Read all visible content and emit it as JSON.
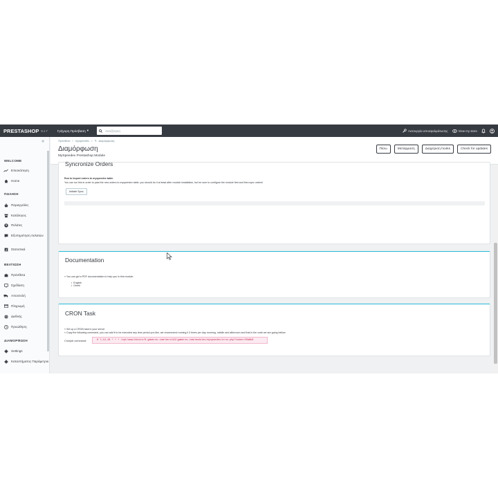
{
  "topbar": {
    "logo": "PRESTASHOP",
    "version": "8.1.7",
    "quick_access": "Γρήγορη Πρόσβαση",
    "search_placeholder": "Αναζήτηση",
    "maintenance": "Λειτουργία αποσφαλμάτωσης",
    "view_store": "View my store"
  },
  "sidebar": {
    "sections": [
      {
        "title": "WELCOME"
      },
      {
        "title": "ΠΩΛΗΣΗ"
      },
      {
        "title": "ΒΕΛΤΙΩΣΗ"
      },
      {
        "title": "ΔΙΑΜΟΡΦΩΣΗ"
      }
    ],
    "items": [
      {
        "label": "Επισκόπηση",
        "icon": "trending-up-icon"
      },
      {
        "label": "Home",
        "icon": "home-icon"
      },
      {
        "label": "Παραγγελίες",
        "icon": "basket-icon"
      },
      {
        "label": "Κατάλογος",
        "icon": "store-icon"
      },
      {
        "label": "Πελάτες",
        "icon": "account-icon"
      },
      {
        "label": "Εξυπηρέτηση πελατών",
        "icon": "chat-icon"
      },
      {
        "label": "Στατιστικά",
        "icon": "stats-icon"
      },
      {
        "label": "Πρόσθετα",
        "icon": "puzzle-icon"
      },
      {
        "label": "Σχεδίαση",
        "icon": "desktop-icon"
      },
      {
        "label": "Αποστολή",
        "icon": "truck-icon"
      },
      {
        "label": "Πληρωμή",
        "icon": "credit-card-icon"
      },
      {
        "label": "Διεθνής",
        "icon": "globe-icon"
      },
      {
        "label": "Προώθηση",
        "icon": "tag-icon"
      },
      {
        "label": "Settings",
        "icon": "gear-icon"
      },
      {
        "label": "Καταστήματος Παράμετροι",
        "icon": "settings-gear-icon"
      }
    ]
  },
  "header": {
    "breadcrumb": [
      "Πρόσθετα",
      "myspeedex",
      "Διαμόρφωση"
    ],
    "title": "Διαμόρφωση",
    "subtitle": "MySpeedex Prestashop Module",
    "buttons": [
      "Πίσω",
      "Μετάφραση",
      "Διαχείριση hooks",
      "Check for updates"
    ]
  },
  "sync": {
    "title": "Syncronize Orders",
    "line1": "Run to Import orders to myspeedex table.",
    "line2": "You can run this in order to past the new orders to myspeedex table, you should do it at least after module installation, but be sure to configure the module first and then sync orders!",
    "button": "Initiate Sync"
  },
  "documentation": {
    "title": "Documentation",
    "intro": "» You can get a PDF documentation to help you in this module :",
    "languages": [
      "English",
      "Greek"
    ]
  },
  "cron": {
    "title": "CRON Task",
    "line1": "» Set up a CRON task to your server",
    "line2": "» Copy the following command, you can add it to be executed any time period you like, we recommend running it 3 times per day morning, middle and afternoon and that is the code we are going bellow",
    "label": "Cronjob command:",
    "command": "0 7,12,18 * * * /opt/www/vhosts/8.gamerzo.com/derulk3/gamerzo.com/modules/myspeedex/cron.php?token=f0a8b8"
  },
  "colors": {
    "topbar": "#363a41",
    "sidebar": "#fafbfc",
    "background": "#eff1f2",
    "accent": "#25b9d7",
    "code": "#c7254e"
  }
}
